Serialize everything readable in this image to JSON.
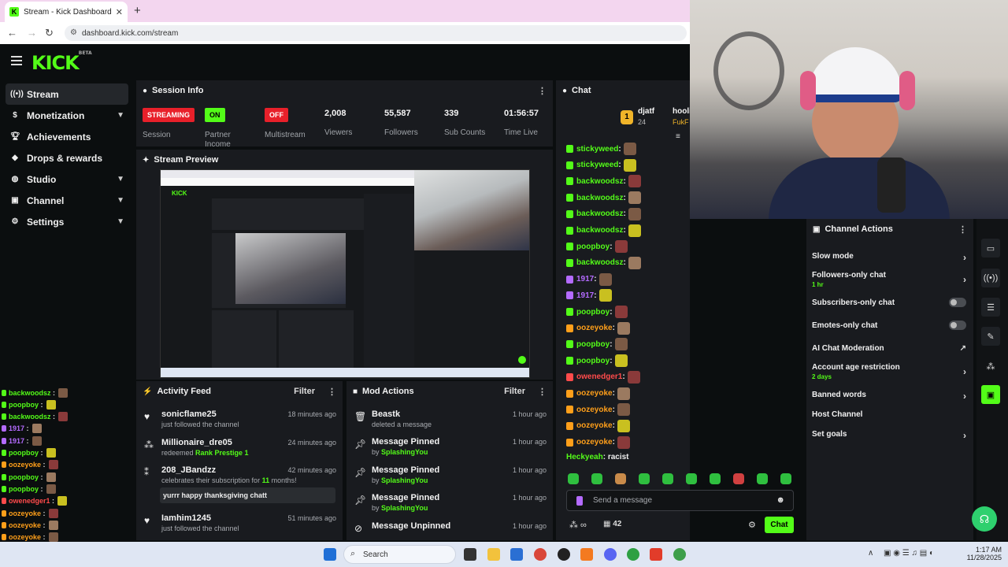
{
  "browser": {
    "tab_title": "Stream - Kick Dashboard",
    "url": "dashboard.kick.com/stream"
  },
  "brand": {
    "logo": "KICK",
    "beta": "BETA",
    "accent": "#53fc18"
  },
  "sidebar": {
    "items": [
      {
        "label": "Stream",
        "icon": "stream-icon"
      },
      {
        "label": "Monetization",
        "icon": "dollar-icon"
      },
      {
        "label": "Achievements",
        "icon": "trophy-icon"
      },
      {
        "label": "Drops & rewards",
        "icon": "gift-icon"
      },
      {
        "label": "Studio",
        "icon": "studio-icon"
      },
      {
        "label": "Channel",
        "icon": "channel-icon"
      },
      {
        "label": "Settings",
        "icon": "gear-icon"
      }
    ]
  },
  "session": {
    "title": "Session Info",
    "stats": [
      {
        "badge": "STREAMING",
        "label": "Session",
        "color": "#e8202a"
      },
      {
        "badge": "ON",
        "label": "Partner Income",
        "color": "#53fc18"
      },
      {
        "badge": "OFF",
        "label": "Multistream",
        "color": "#e8202a"
      },
      {
        "value": "2,008",
        "label": "Viewers"
      },
      {
        "value": "55,587",
        "label": "Followers"
      },
      {
        "value": "339",
        "label": "Sub Counts"
      },
      {
        "value": "01:56:57",
        "label": "Time Live"
      }
    ]
  },
  "preview": {
    "title": "Stream Preview"
  },
  "activity": {
    "title": "Activity Feed",
    "filter": "Filter",
    "items": [
      {
        "name": "sonicflame25",
        "sub": "just followed the channel",
        "time": "18 minutes ago"
      },
      {
        "name": "Millionaire_dre05",
        "sub": "redeemed ",
        "sub_hl": "Rank Prestige 1",
        "time": "24 minutes ago"
      },
      {
        "name": "208_JBandzz",
        "sub": "celebrates their subscription for ",
        "sub_hl": "11",
        "sub_end": " months!",
        "message": "yurrr happy thanksgiving chatt",
        "time": "42 minutes ago"
      },
      {
        "name": "Iamhim1245",
        "sub": "just followed the channel",
        "time": "51 minutes ago"
      }
    ]
  },
  "mod": {
    "title": "Mod Actions",
    "filter": "Filter",
    "items": [
      {
        "name": "Beastk",
        "sub": "deleted a message",
        "time": "1 hour ago"
      },
      {
        "name": "Message Pinned",
        "sub": "by ",
        "sub_hl": "SplashingYou",
        "time": "1 hour ago"
      },
      {
        "name": "Message Pinned",
        "sub": "by ",
        "sub_hl": "SplashingYou",
        "time": "1 hour ago"
      },
      {
        "name": "Message Pinned",
        "sub": "by ",
        "sub_hl": "SplashingYou",
        "time": "1 hour ago"
      },
      {
        "name": "Message Unpinned",
        "sub": "",
        "time": "1 hour ago"
      }
    ]
  },
  "chat": {
    "title": "Chat",
    "top_users": [
      {
        "name": "djatf",
        "count": "24"
      },
      {
        "name": "hooli"
      },
      {
        "name": "FukF"
      }
    ],
    "lines": [
      {
        "user": "stickyweed",
        "color": "#53fc18"
      },
      {
        "user": "stickyweed",
        "color": "#53fc18"
      },
      {
        "user": "backwoodsz",
        "color": "#53fc18"
      },
      {
        "user": "backwoodsz",
        "color": "#53fc18"
      },
      {
        "user": "backwoodsz",
        "color": "#53fc18"
      },
      {
        "user": "backwoodsz",
        "color": "#53fc18"
      },
      {
        "user": "poopboy",
        "color": "#53fc18"
      },
      {
        "user": "backwoodsz",
        "color": "#53fc18"
      },
      {
        "user": "1917",
        "color": "#b46bff"
      },
      {
        "user": "1917",
        "color": "#b46bff"
      },
      {
        "user": "poopboy",
        "color": "#53fc18"
      },
      {
        "user": "oozeyoke",
        "color": "#ff9f1a"
      },
      {
        "user": "poopboy",
        "color": "#53fc18"
      },
      {
        "user": "poopboy",
        "color": "#53fc18"
      },
      {
        "user": "owenedger1",
        "color": "#ff4b4b"
      },
      {
        "user": "oozeyoke",
        "color": "#ff9f1a"
      },
      {
        "user": "oozeyoke",
        "color": "#ff9f1a"
      },
      {
        "user": "oozeyoke",
        "color": "#ff9f1a"
      },
      {
        "user": "oozeyoke",
        "color": "#ff9f1a"
      }
    ],
    "last_user": "Heckyeah",
    "last_text": "racist",
    "placeholder": "Send a message",
    "viewer_count": "42",
    "send_label": "Chat"
  },
  "channel_actions": {
    "title": "Channel Actions",
    "items": [
      {
        "label": "Slow mode",
        "kind": "chevron"
      },
      {
        "label": "Followers-only chat",
        "sub": "1 hr",
        "kind": "chevron"
      },
      {
        "label": "Subscribers-only chat",
        "kind": "toggle"
      },
      {
        "label": "Emotes-only chat",
        "kind": "toggle"
      },
      {
        "label": "AI Chat Moderation",
        "kind": "external"
      },
      {
        "label": "Account age restriction",
        "sub": "2 days",
        "kind": "chevron"
      },
      {
        "label": "Banned words",
        "kind": "chevron"
      },
      {
        "label": "Host Channel",
        "kind": "none"
      },
      {
        "label": "Set goals",
        "kind": "chevron"
      }
    ]
  },
  "overlay_chat": [
    {
      "user": "backwoodsz",
      "color": "#53fc18"
    },
    {
      "user": "poopboy",
      "color": "#53fc18"
    },
    {
      "user": "backwoodsz",
      "color": "#53fc18"
    },
    {
      "user": "1917",
      "color": "#b46bff"
    },
    {
      "user": "1917",
      "color": "#b46bff"
    },
    {
      "user": "poopboy",
      "color": "#53fc18"
    },
    {
      "user": "oozeyoke",
      "color": "#ff9f1a"
    },
    {
      "user": "poopboy",
      "color": "#53fc18"
    },
    {
      "user": "poopboy",
      "color": "#53fc18"
    },
    {
      "user": "owenedger1",
      "color": "#ff4b4b"
    },
    {
      "user": "oozeyoke",
      "color": "#ff9f1a"
    },
    {
      "user": "oozeyoke",
      "color": "#ff9f1a"
    },
    {
      "user": "oozeyoke",
      "color": "#ff9f1a"
    },
    {
      "user": "oozeyoke",
      "color": "#ff9f1a"
    }
  ],
  "taskbar": {
    "search": "Search",
    "time": "1:17 AM",
    "date": "11/28/2025"
  }
}
